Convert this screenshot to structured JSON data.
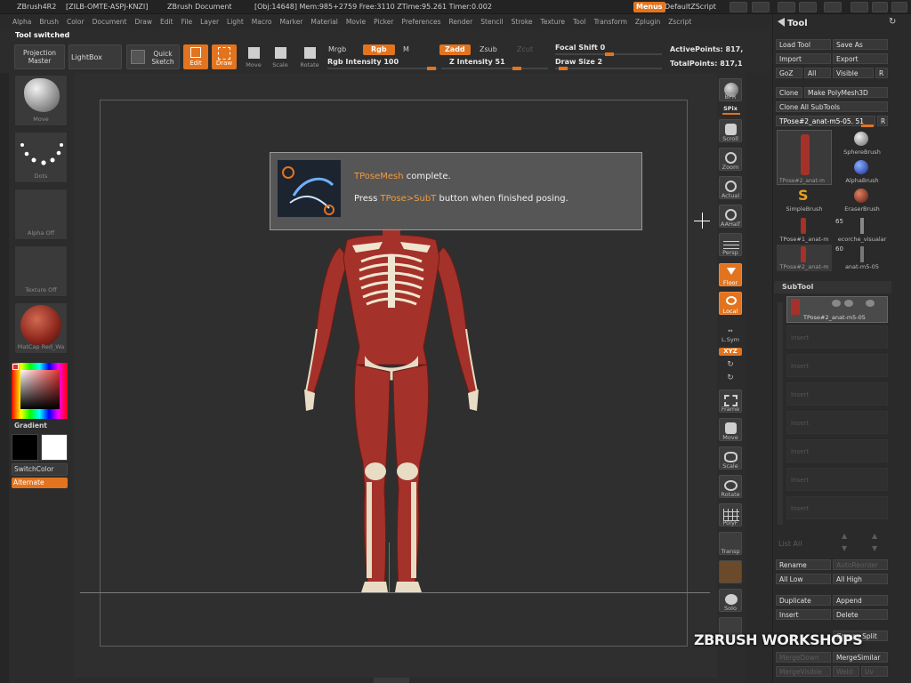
{
  "titlebar": {
    "app": "ZBrush4R2",
    "serial": "[ZILB-OMTE-ASPJ-KNZI]",
    "document": "ZBrush Document",
    "stats": "[Obj:14648] Mem:985+2759 Free:3110 ZTime:95.261 Timer:0.002",
    "menus_btn": "Menus",
    "script": "DefaultZScript"
  },
  "menubar": {
    "items": [
      "Alpha",
      "Brush",
      "Color",
      "Document",
      "Draw",
      "Edit",
      "File",
      "Layer",
      "Light",
      "Macro",
      "Marker",
      "Material",
      "Movie",
      "Picker",
      "Preferences",
      "Render",
      "Stencil",
      "Stroke",
      "Texture",
      "Tool",
      "Transform",
      "Zplugin",
      "Zscript"
    ]
  },
  "toolbar": {
    "status": "Tool switched",
    "projection_master": "Projection Master",
    "lightbox": "LightBox",
    "quick_sketch": "Quick Sketch",
    "edit": "Edit",
    "draw": "Draw",
    "move": "Move",
    "scale": "Scale",
    "rotate": "Rotate",
    "mrgb": "Mrgb",
    "rgb": "Rgb",
    "m": "M",
    "rgb_intensity": "Rgb Intensity 100",
    "zadd": "Zadd",
    "zsub": "Zsub",
    "zcut": "Zcut",
    "z_intensity": "Z Intensity 51",
    "focal_shift": "Focal Shift 0",
    "draw_size": "Draw Size 2",
    "active_points": "ActivePoints: 817,",
    "total_points": "TotalPoints: 817,1"
  },
  "leftshelf": {
    "brush": "Move",
    "stroke": "Dots",
    "alpha": "Alpha Off",
    "texture": "Texture Off",
    "material": "MatCap Red_Wa",
    "gradient": "Gradient",
    "switch_color": "SwitchColor",
    "alternate": "Alternate"
  },
  "rightshelf": {
    "bpr": "BPR",
    "spix": "SPix",
    "scroll": "Scroll",
    "zoom": "Zoom",
    "actual": "Actual",
    "aahalf": "AAHalf",
    "persp": "Persp",
    "floor": "Floor",
    "local": "Local",
    "lsym": "L.Sym",
    "xyz": "XYZ",
    "frame": "Frame",
    "move": "Move",
    "scale": "Scale",
    "rotate": "Rotate",
    "polyf": "PolyF",
    "transp": "Transp",
    "solo": "Solo"
  },
  "popup": {
    "highlight1": "TPoseMesh",
    "line1_rest": " complete.",
    "press": "Press ",
    "highlight2": "TPose>SubT",
    "line2_rest": " button when finished posing."
  },
  "panel": {
    "title": "Tool",
    "load_tool": "Load Tool",
    "save_as": "Save As",
    "import": "Import",
    "export": "Export",
    "goz": "GoZ",
    "all": "All",
    "visible": "Visible",
    "r": "R",
    "clone": "Clone",
    "make_polymesh": "Make PolyMesh3D",
    "clone_all": "Clone All SubTools",
    "current_tool": "TPose#2_anat-m5-05. 51",
    "tools": [
      {
        "label": "TPose#2_anat-m"
      },
      {
        "label": "SphereBrush"
      },
      {
        "label": "AlphaBrush"
      },
      {
        "label": "SimpleBrush"
      },
      {
        "label": "EraserBrush"
      },
      {
        "label": "TPose#1_anat-m"
      },
      {
        "label": "ecorche_visualar"
      },
      {
        "label": "TPose#2_anat-m"
      },
      {
        "label": "anat-m5-05"
      }
    ],
    "count65": "65",
    "count60": "60",
    "subtool_header": "SubTool",
    "subtool_active": "TPose#2_anat-m5-05",
    "empty_slots": [
      "Insert",
      "Insert",
      "Insert",
      "Insert",
      "Insert",
      "Insert",
      "Insert"
    ],
    "list_all": "List All",
    "rename": "Rename",
    "auto_reorder": "AutoReorder",
    "all_low": "All Low",
    "all_high": "All High",
    "duplicate": "Duplicate",
    "append": "Append",
    "insert": "Insert",
    "delete": "Delete",
    "group_split": "Groups Split",
    "merge_down": "MergeDown",
    "merge_similar": "MergeSimilar",
    "merge_visible": "MergeVisible",
    "weld": "Weld",
    "uv": "Uv"
  },
  "watermark": "ZBRUSH WORKSHOPS",
  "colors": {
    "accent": "#e2741f",
    "panel": "#2a2a2a",
    "canvas": "#2f2f2f",
    "muscle": "#a4322a",
    "bone": "#e8dcc4"
  }
}
